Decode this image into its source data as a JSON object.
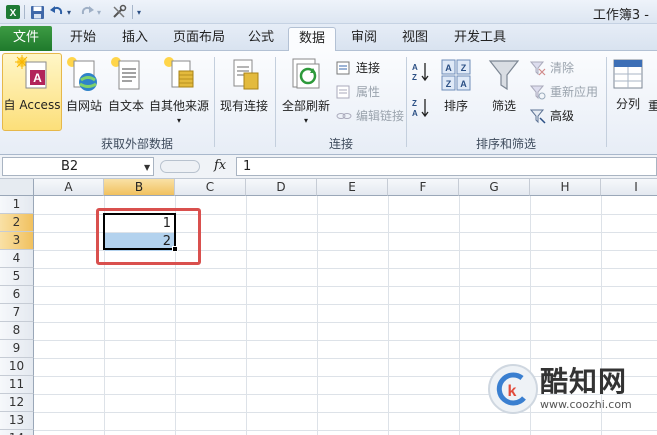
{
  "window": {
    "title": "工作簿3 -"
  },
  "quick_access": {
    "undo_arrow": "▾",
    "redo_arrow": "▾",
    "customize": "▾"
  },
  "tabs": [
    {
      "label": "文件"
    },
    {
      "label": "开始"
    },
    {
      "label": "插入"
    },
    {
      "label": "页面布局"
    },
    {
      "label": "公式"
    },
    {
      "label": "数据"
    },
    {
      "label": "审阅"
    },
    {
      "label": "视图"
    },
    {
      "label": "开发工具"
    }
  ],
  "active_tab": "数据",
  "ribbon": {
    "get_external": {
      "label": "获取外部数据",
      "access": "自 Access",
      "web": "自网站",
      "text": "自文本",
      "other": "自其他来源",
      "other_arrow": "▾",
      "existing": "现有连接"
    },
    "connections": {
      "label": "连接",
      "refresh_all": "全部刷新",
      "refresh_arrow": "▾",
      "connect": "连接",
      "properties": "属性",
      "edit_links": "编辑链接"
    },
    "sort_filter": {
      "label": "排序和筛选",
      "sort": "排序",
      "filter": "筛选",
      "clear": "清除",
      "reapply": "重新应用",
      "advanced": "高级"
    },
    "data_tools": {
      "split": "分列",
      "partial": "重"
    }
  },
  "formula_bar": {
    "name_box": "B2",
    "fx": "fx",
    "value": "1"
  },
  "grid": {
    "columns": [
      "A",
      "B",
      "C",
      "D",
      "E",
      "F",
      "G",
      "H",
      "I"
    ],
    "rows": [
      "1",
      "2",
      "3",
      "4",
      "5",
      "6",
      "7",
      "8",
      "9",
      "10",
      "11",
      "12",
      "13",
      "14"
    ],
    "cells": {
      "B2": "1",
      "B3": "2"
    }
  },
  "watermark": {
    "name": "酷知网",
    "url": "www.coozhi.com"
  },
  "colors": {
    "file_tab": "#1f7a2c",
    "selection_highlight": "#b3d2ee",
    "annotation_red": "#d9504e",
    "header_selected": "#f1c15f"
  }
}
